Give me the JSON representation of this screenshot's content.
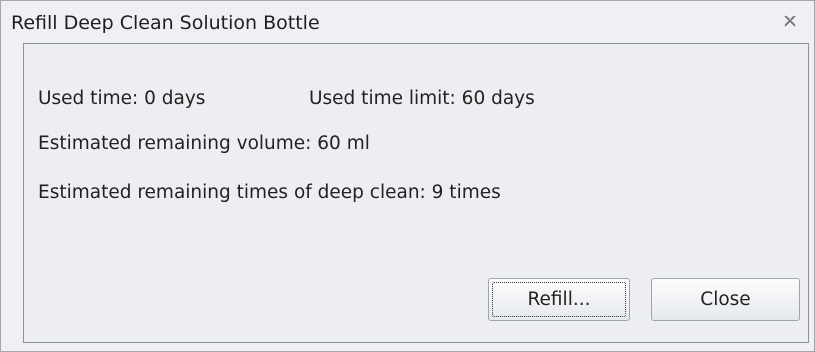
{
  "dialog": {
    "title": "Refill Deep Clean Solution Bottle",
    "close_icon": "close-x-icon"
  },
  "info": {
    "used_time": "Used time: 0 days",
    "used_time_limit": "Used time limit: 60 days",
    "remaining_volume": "Estimated remaining volume: 60 ml",
    "remaining_times": "Estimated remaining times of deep clean: 9 times"
  },
  "buttons": {
    "refill_label": "Refill...",
    "close_label": "Close"
  }
}
